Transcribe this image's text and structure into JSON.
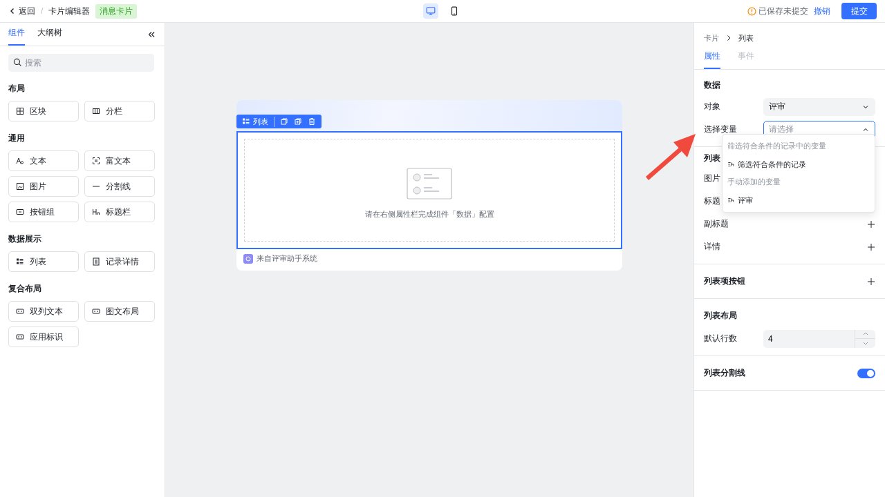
{
  "topbar": {
    "back": "返回",
    "separator": "/",
    "title": "卡片编辑器",
    "tag": "消息卡片",
    "devices": [
      {
        "kind": "desktop",
        "selected": true
      },
      {
        "kind": "mobile",
        "selected": false
      }
    ],
    "status": "已保存未提交",
    "revoke": "撤销",
    "submit": "提交"
  },
  "left_panel": {
    "tabs": [
      {
        "label": "组件",
        "selected": true
      },
      {
        "label": "大纲树",
        "selected": false
      }
    ],
    "search": {
      "placeholder": "搜索"
    },
    "groups": [
      {
        "title": "布局",
        "items": [
          {
            "label": "区块",
            "kind": "block"
          },
          {
            "label": "分栏",
            "kind": "columns"
          }
        ]
      },
      {
        "title": "通用",
        "items": [
          {
            "label": "文本",
            "kind": "text"
          },
          {
            "label": "富文本",
            "kind": "richtext"
          },
          {
            "label": "图片",
            "kind": "image"
          },
          {
            "label": "分割线",
            "kind": "divider"
          },
          {
            "label": "按钮组",
            "kind": "buttons"
          },
          {
            "label": "标题栏",
            "kind": "heading"
          }
        ]
      },
      {
        "title": "数据展示",
        "items": [
          {
            "label": "列表",
            "kind": "list"
          },
          {
            "label": "记录详情",
            "kind": "detail"
          }
        ]
      },
      {
        "title": "复合布局",
        "items": [
          {
            "label": "双列文本",
            "kind": "twocol"
          },
          {
            "label": "图文布局",
            "kind": "imagetext"
          },
          {
            "label": "应用标识",
            "kind": "applabel"
          }
        ]
      }
    ]
  },
  "canvas": {
    "card": {
      "toolbar": {
        "label": "列表"
      },
      "empty_hint": "请在右侧属性栏完成组件「数据」配置",
      "footer": "来自评审助手系统"
    }
  },
  "right_panel": {
    "breadcrumb": [
      "卡片",
      "列表"
    ],
    "tabs": [
      {
        "label": "属性",
        "selected": true
      },
      {
        "label": "事件",
        "selected": false
      }
    ],
    "data_section": {
      "title": "数据",
      "object": {
        "label": "对象",
        "value": "评审",
        "expanded": false
      },
      "variable": {
        "label": "选择变量",
        "placeholder": "请选择",
        "expanded": true
      },
      "dropdown": [
        {
          "title": "筛选符合条件的记录中的变量",
          "items": [
            "筛选符合条件的记录"
          ]
        },
        {
          "title": "手动添加的变量",
          "items": [
            "评审"
          ]
        }
      ]
    },
    "fields_section": {
      "title": "列表",
      "rows": [
        {
          "label": "图片",
          "addable": false
        },
        {
          "label": "标题",
          "addable": false
        },
        {
          "label": "副标题",
          "addable": true
        },
        {
          "label": "详情",
          "addable": true
        }
      ]
    },
    "button_section": {
      "title": "列表项按钮",
      "addable": true
    },
    "layout_section": {
      "title": "列表布局",
      "rows_field": {
        "label": "默认行数",
        "value": "4"
      }
    },
    "divider_section": {
      "title": "列表分割线",
      "on": true
    }
  }
}
